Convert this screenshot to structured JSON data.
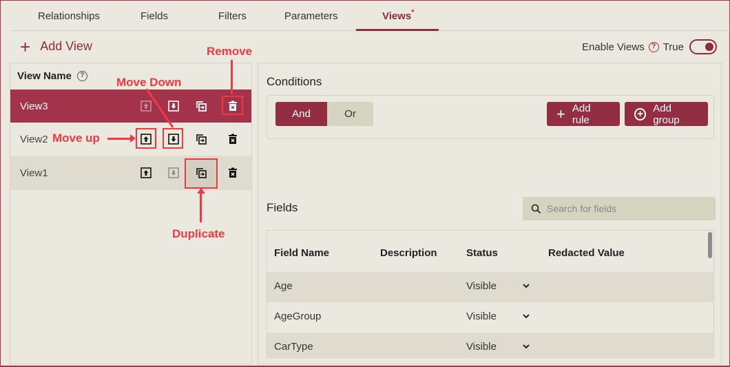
{
  "tabs": [
    {
      "label": "Relationships",
      "active": false
    },
    {
      "label": "Fields",
      "active": false
    },
    {
      "label": "Filters",
      "active": false
    },
    {
      "label": "Parameters",
      "active": false
    },
    {
      "label": "Views",
      "active": true,
      "modified_marker": "*"
    }
  ],
  "toolbar": {
    "add_view_label": "Add View",
    "add_view_icon": "plus-icon",
    "enable_views_label": "Enable Views",
    "enable_views_help_icon": "question-circle-icon",
    "enable_views_value": "True",
    "enable_views_on": true
  },
  "views_panel": {
    "header": "View Name",
    "header_help_icon": "question-circle-icon",
    "views": [
      {
        "name": "View3",
        "selected": true,
        "move_up_enabled": false,
        "move_down_enabled": true
      },
      {
        "name": "View2",
        "selected": false,
        "move_up_enabled": true,
        "move_down_enabled": true
      },
      {
        "name": "View1",
        "selected": false,
        "move_up_enabled": true,
        "move_down_enabled": false,
        "duplicate_hovered": true
      }
    ],
    "row_actions": [
      "move-up-icon",
      "move-down-icon",
      "duplicate-icon",
      "delete-icon"
    ]
  },
  "conditions": {
    "title": "Conditions",
    "logic_options": [
      "And",
      "Or"
    ],
    "selected_logic": "And",
    "add_rule_label": "Add rule",
    "add_group_label": "Add group"
  },
  "fields": {
    "title": "Fields",
    "search_placeholder": "Search for fields",
    "columns": [
      "Field Name",
      "Description",
      "Status",
      "Redacted Value"
    ],
    "rows": [
      {
        "field_name": "Age",
        "description": "",
        "status": "Visible",
        "redacted_value": ""
      },
      {
        "field_name": "AgeGroup",
        "description": "",
        "status": "Visible",
        "redacted_value": ""
      },
      {
        "field_name": "CarType",
        "description": "",
        "status": "Visible",
        "redacted_value": ""
      }
    ]
  },
  "annotations": {
    "remove": "Remove",
    "move_down": "Move Down",
    "move_up": "Move up",
    "duplicate": "Duplicate"
  },
  "colors": {
    "accent": "#932d42",
    "selected_row": "#a2334a",
    "annotation": "#f0383f",
    "background": "#ebe8e0"
  }
}
